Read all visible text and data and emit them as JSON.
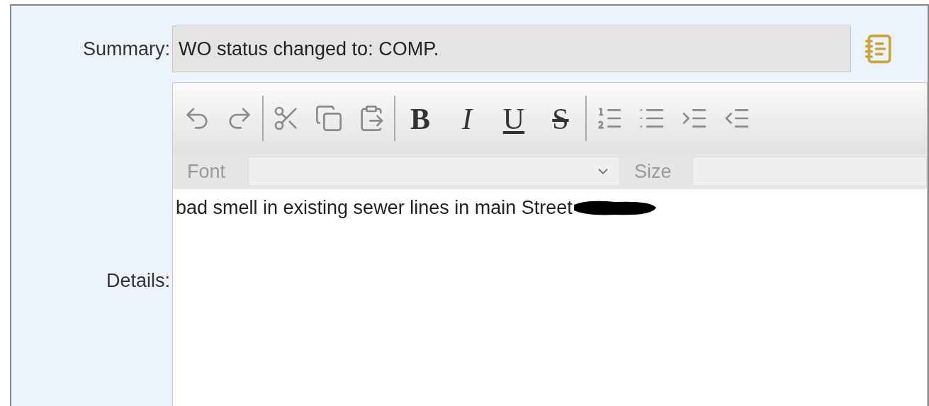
{
  "summary": {
    "label": "Summary:",
    "value": "WO status changed to: COMP."
  },
  "toolbar": {
    "format_buttons": [
      {
        "label": "B",
        "kind": "bold"
      },
      {
        "label": "I",
        "kind": "italic"
      },
      {
        "label": "U",
        "kind": "underline"
      },
      {
        "label": "S",
        "kind": "strike"
      }
    ]
  },
  "font_row": {
    "font_label": "Font",
    "size_label": "Size"
  },
  "details": {
    "label": "Details:",
    "text": "bad smell in existing sewer lines in main Street"
  }
}
